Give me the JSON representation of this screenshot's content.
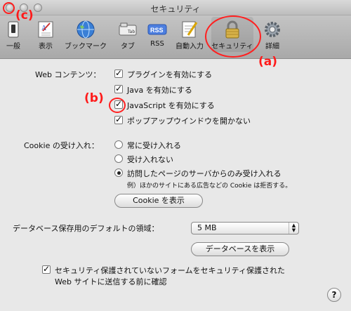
{
  "window": {
    "title": "セキュリティ"
  },
  "toolbar": {
    "items": [
      {
        "label": "一般",
        "icon": "switch-icon"
      },
      {
        "label": "表示",
        "icon": "appearance-icon"
      },
      {
        "label": "ブックマーク",
        "icon": "globe-icon"
      },
      {
        "label": "タブ",
        "icon": "tab-icon"
      },
      {
        "label": "RSS",
        "icon": "rss-icon"
      },
      {
        "label": "自動入力",
        "icon": "pencil-icon"
      },
      {
        "label": "セキュリティ",
        "icon": "lock-icon",
        "selected": true
      },
      {
        "label": "詳細",
        "icon": "gear-icon"
      }
    ]
  },
  "annotations": {
    "a": "(a)",
    "b": "(b)",
    "c": "(c)",
    "color": "#ff1a1a"
  },
  "web_content": {
    "label": "Web コンテンツ：",
    "options": [
      {
        "label": "プラグインを有効にする",
        "checked": true
      },
      {
        "label": "Java を有効にする",
        "checked": true
      },
      {
        "label": "JavaScript を有効にする",
        "checked": true
      },
      {
        "label": "ポップアップウインドウを開かない",
        "checked": true
      }
    ]
  },
  "cookies": {
    "label": "Cookie の受け入れ：",
    "options": [
      {
        "label": "常に受け入れる",
        "selected": false
      },
      {
        "label": "受け入れない",
        "selected": false
      },
      {
        "label": "訪問したページのサーバからのみ受け入れる",
        "selected": true
      }
    ],
    "note": "例）ほかのサイトにある広告などの Cookie は拒否する。",
    "show_button": "Cookie を表示"
  },
  "database": {
    "label": "データベース保存用のデフォルトの領域：",
    "selected_value": "5 MB",
    "show_button": "データベースを表示"
  },
  "security_warning": {
    "line1": "セキュリティ保護されていないフォームをセキュリティ保護された",
    "line2": "Web サイトに送信する前に確認",
    "checked": true
  },
  "help": {
    "label": "?"
  }
}
